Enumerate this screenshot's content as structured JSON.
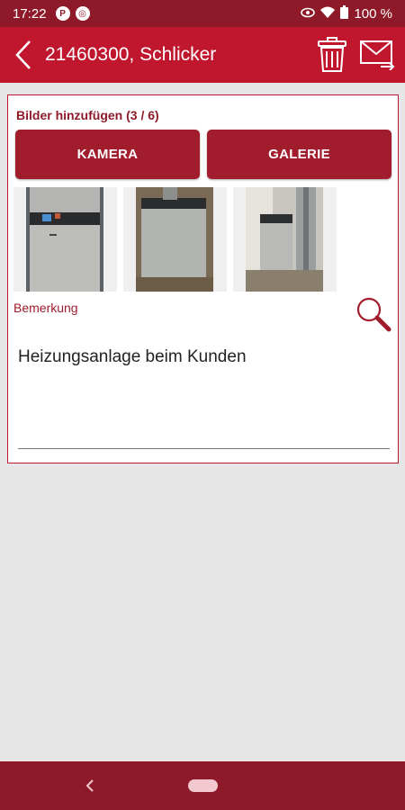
{
  "status_bar": {
    "time": "17:22",
    "battery": "100 %",
    "icons": [
      "notification-p-icon",
      "notification-badge-icon",
      "eye-icon",
      "wifi-icon",
      "battery-icon"
    ]
  },
  "app_bar": {
    "title": "21460300, Schlicker",
    "icons": [
      "back-icon",
      "trash-icon",
      "mail-forward-icon"
    ]
  },
  "images_section": {
    "title": "Bilder hinzufügen (3 / 6)",
    "camera_button": "KAMERA",
    "gallery_button": "GALERIE",
    "thumbnails": [
      "heating-unit-photo-1",
      "heating-unit-photo-2",
      "heating-unit-photo-3"
    ]
  },
  "remark": {
    "label": "Bemerkung",
    "value": "Heizungsanlage beim Kunden",
    "search_icon": "magnifier-icon"
  },
  "nav_bar": {
    "icons": [
      "nav-back-icon",
      "nav-home-pill"
    ]
  },
  "colors": {
    "status_bar": "#8e1a29",
    "app_bar": "#c0172f",
    "button": "#a11c2c",
    "background": "#e6e6e6"
  }
}
